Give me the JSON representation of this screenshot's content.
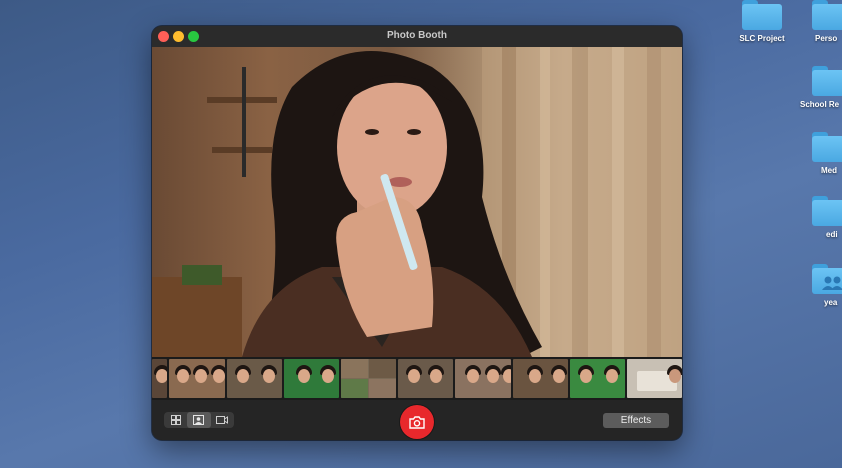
{
  "window": {
    "title": "Photo Booth"
  },
  "toolbar": {
    "modes": [
      {
        "icon": "grid-4-up-icon",
        "label": "⊞"
      },
      {
        "icon": "single-photo-icon",
        "label": "▣"
      },
      {
        "icon": "video-icon",
        "label": "▭"
      }
    ],
    "active_mode_index": 1,
    "shutter_icon": "camera-icon",
    "effects_label": "Effects"
  },
  "thumbnails": [
    {
      "bg": "#5a4638"
    },
    {
      "bg": "#8a6a50"
    },
    {
      "bg": "#6a5a48"
    },
    {
      "bg": "#7a6450"
    },
    {
      "bg": "#2f7a3a"
    },
    {
      "bg": "#7a6a56"
    },
    {
      "bg": "#6a5a4a"
    },
    {
      "bg": "#8a7260"
    },
    {
      "bg": "#6a5440"
    },
    {
      "bg": "#3a8a40"
    },
    {
      "bg": "#c8c0b4"
    }
  ],
  "desktop": {
    "items": [
      {
        "label": "SLC Project",
        "icon": "folder-icon"
      },
      {
        "label": "Perso",
        "icon": "folder-icon"
      },
      {
        "label": "School Re",
        "icon": "folder-icon"
      },
      {
        "label": "Med",
        "icon": "folder-icon"
      },
      {
        "label": "edi",
        "icon": "folder-icon"
      },
      {
        "label": "yea",
        "icon": "shared-folder-icon"
      }
    ]
  }
}
